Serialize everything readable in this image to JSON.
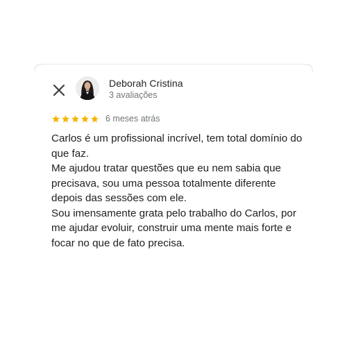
{
  "reviewer": {
    "name": "Deborah Cristina",
    "review_count": "3 avaliações"
  },
  "rating": {
    "stars": 5,
    "max": 5,
    "color": "#f4b400",
    "date": "6 meses atrás"
  },
  "review": {
    "paragraphs": [
      "Carlos é um profissional incrível, tem total domínio do que faz.",
      "Me ajudou tratar questões que eu nem sabia que precisava, sou uma pessoa totalmente diferente depois das sessões com ele.",
      "Sou imensamente grata pelo trabalho do Carlos, por me ajudar evoluir, construir uma mente mais forte e focar no que de fato precisa."
    ]
  },
  "icons": {
    "close": "close-icon",
    "star": "star-icon"
  }
}
